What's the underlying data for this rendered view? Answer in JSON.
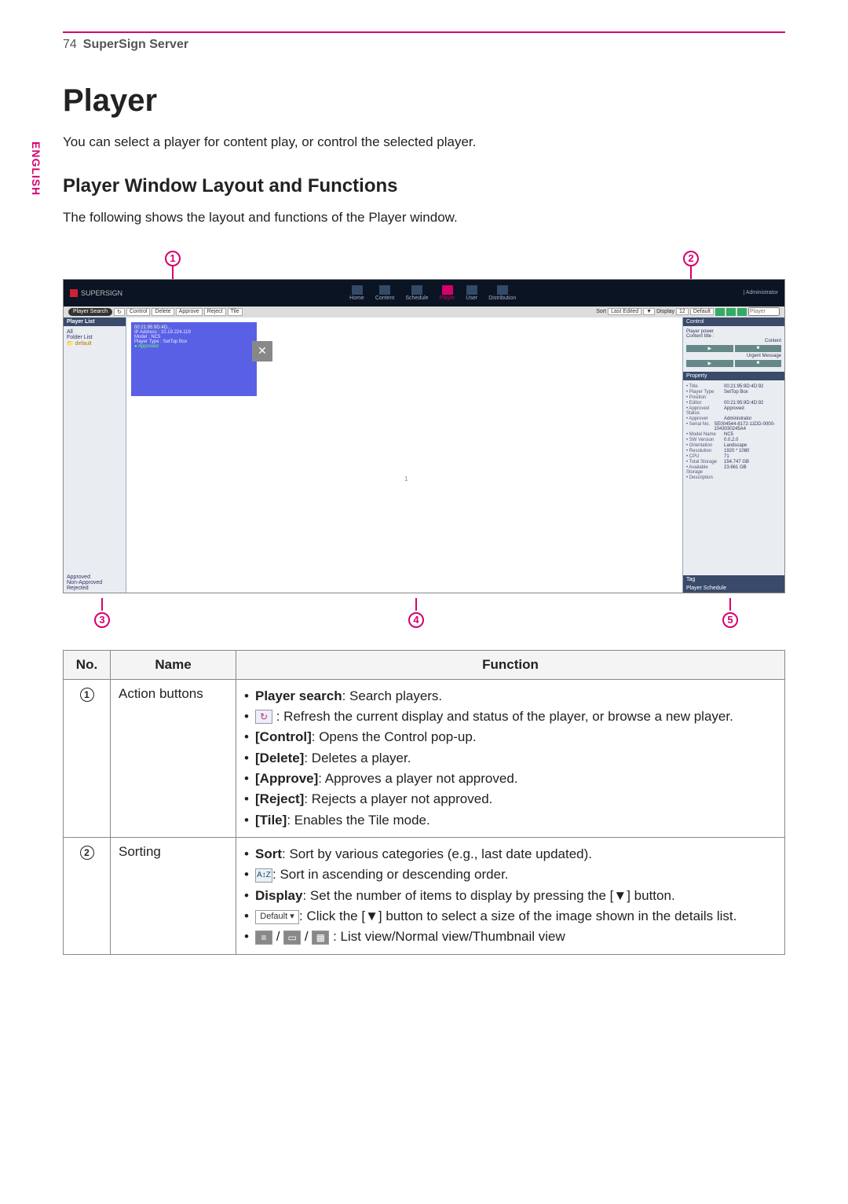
{
  "page_number": "74",
  "header_title": "SuperSign Server",
  "side_tab": "ENGLISH",
  "h1": "Player",
  "intro": "You can select a player for content play, or control the selected player.",
  "h2": "Player Window Layout and Functions",
  "intro2": "The following shows the layout and functions of the Player window.",
  "callouts": {
    "c1": "1",
    "c2": "2",
    "c3": "3",
    "c4": "4",
    "c5": "5"
  },
  "screenshot": {
    "brand": "SUPERSIGN",
    "nav": [
      "Home",
      "Content",
      "Schedule",
      "Player",
      "User",
      "Distribution"
    ],
    "user": "| Administrator",
    "player_search_label": "Player Search",
    "action_buttons": [
      "Control",
      "Delete",
      "Approve",
      "Reject",
      "Tile"
    ],
    "sort_label": "Sort",
    "sort_value": "Last Edited",
    "display_label": "Display",
    "display_value": "12",
    "default_label": "Default",
    "search_ph": "Player",
    "left_header": "Player List",
    "left_all": "All",
    "left_folder": "Folder List",
    "left_default_folder": "default",
    "left_bottom": [
      "Approved",
      "Non-Approved",
      "Rejected"
    ],
    "card": {
      "title": "00:21:95:9D:4D...",
      "ip": "IP Address : 10.19.224.119",
      "model": "Model : NC5",
      "ptype": "Player Type : SetTop Box",
      "approved": "Approved"
    },
    "right_header": "Control",
    "right_power": "Player power",
    "right_title": "Content title :",
    "right_content": "Content",
    "right_urgent": "Urgent Message",
    "right_property": "Property",
    "props": [
      {
        "k": "Title",
        "v": "00:21:95:9D:4D:92"
      },
      {
        "k": "Player Type",
        "v": "SetTop Box"
      },
      {
        "k": "Position",
        "v": ""
      },
      {
        "k": "Editor",
        "v": "00:21:95:9D:4D:92"
      },
      {
        "k": "Approved Status",
        "v": "Approved"
      },
      {
        "k": "Approver",
        "v": "Administrator"
      },
      {
        "k": "Serial No.",
        "v": "SE004544-8172-11DD-0000-1043030245A4"
      },
      {
        "k": "Model Name",
        "v": "NC5"
      },
      {
        "k": "SW Version",
        "v": "0.0.2.0"
      },
      {
        "k": "Orientation",
        "v": "Landscape"
      },
      {
        "k": "Resolution",
        "v": "1920 * 1080"
      },
      {
        "k": "CPU",
        "v": "71"
      },
      {
        "k": "Total Storage",
        "v": "154.747 GB"
      },
      {
        "k": "Available Storage",
        "v": "23.661 GB"
      },
      {
        "k": "Description",
        "v": ""
      }
    ],
    "right_tag": "Tag",
    "right_schedule": "Player Schedule"
  },
  "table": {
    "head": {
      "no": "No.",
      "name": "Name",
      "func": "Function"
    },
    "rows": [
      {
        "no": "1",
        "name": "Action buttons",
        "items": [
          {
            "b": "Player search",
            "t": ": Search players."
          },
          {
            "icon": "refresh",
            "t": " : Refresh the current display and status of the player, or browse a new player."
          },
          {
            "b": "[Control]",
            "t": ": Opens the Control pop-up."
          },
          {
            "b": "[Delete]",
            "t": ": Deletes a player."
          },
          {
            "b": "[Approve]",
            "t": ": Approves a player not approved."
          },
          {
            "b": "[Reject]",
            "t": ": Rejects a player not approved."
          },
          {
            "b": "[Tile]",
            "t": ": Enables the Tile mode."
          }
        ]
      },
      {
        "no": "2",
        "name": "Sorting",
        "items": [
          {
            "b": "Sort",
            "t": ": Sort by various categories (e.g., last date updated)."
          },
          {
            "icon": "az",
            "t": ": Sort in ascending or descending order."
          },
          {
            "b": "Display",
            "t": ": Set the number of items to display by pressing the [▼] button."
          },
          {
            "icon": "default",
            "t": ": Click the [▼] button to select a size of the image shown in the details list."
          },
          {
            "icon": "views",
            "t": " : List view/Normal view/Thumbnail view"
          }
        ]
      }
    ]
  }
}
